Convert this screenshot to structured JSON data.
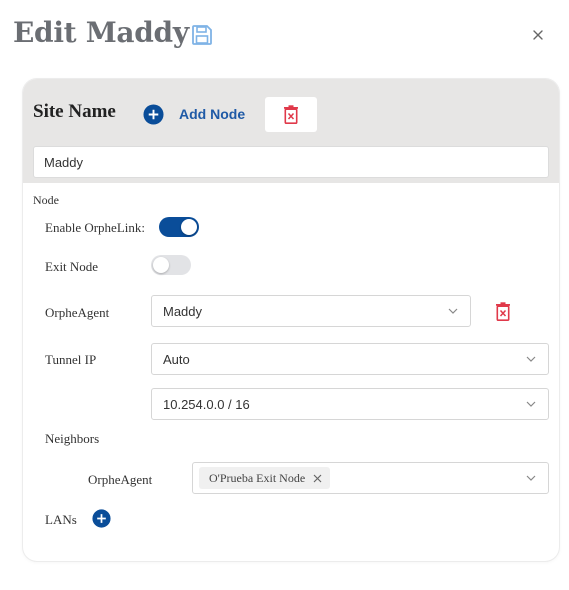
{
  "header": {
    "title": "Edit Maddy",
    "save_icon": "save-icon",
    "close_icon": "close-icon"
  },
  "site": {
    "label": "Site Name",
    "add_node_label": "Add Node",
    "name_value": "Maddy",
    "delete_icon": "trash-icon"
  },
  "node": {
    "section_label": "Node",
    "enable_orphelink": {
      "label": "Enable OrpheLink:",
      "on": true
    },
    "exit_node": {
      "label": "Exit Node",
      "on": false
    },
    "orphe_agent": {
      "label": "OrpheAgent",
      "value": "Maddy"
    },
    "tunnel_ip": {
      "label": "Tunnel IP",
      "mode": "Auto",
      "subnet": "10.254.0.0 / 16"
    },
    "neighbors": {
      "label": "Neighbors",
      "orphe_agent_label": "OrpheAgent",
      "tags": [
        "O'Prueba Exit Node"
      ]
    },
    "lans": {
      "label": "LANs"
    }
  },
  "colors": {
    "accent": "#0a4d99",
    "delete": "#e0394a",
    "save_icon": "#7fb3e6",
    "title": "#6b6e73"
  }
}
